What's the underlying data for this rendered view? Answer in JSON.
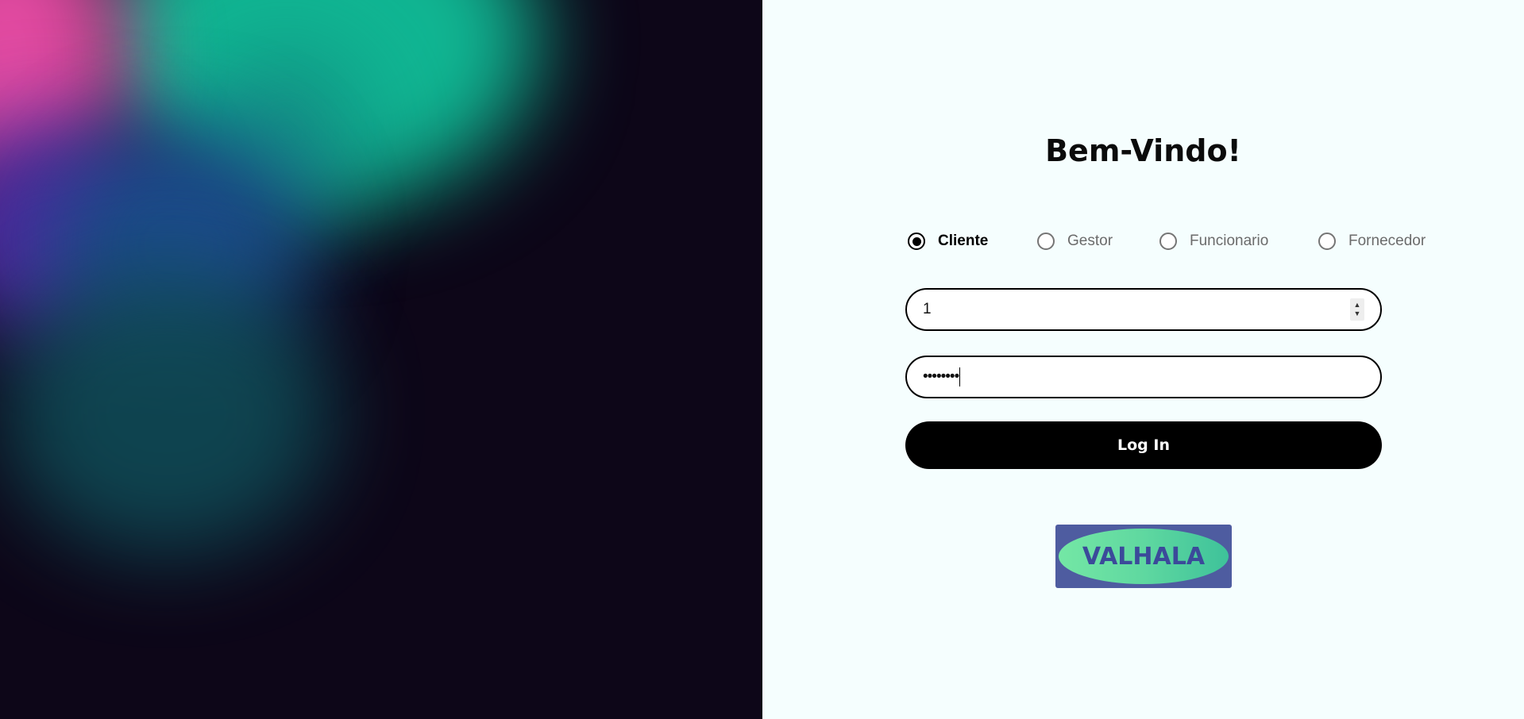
{
  "colors": {
    "left_background": "#0d0618",
    "right_background": "#f5fefe",
    "button_background": "#000000",
    "button_text": "#ffffff",
    "logo_background": "#4e5ca0",
    "logo_text": "#3b4a9a"
  },
  "login": {
    "title": "Bem-Vindo!",
    "roles": [
      {
        "label": "Cliente",
        "selected": true
      },
      {
        "label": "Gestor",
        "selected": false
      },
      {
        "label": "Funcionario",
        "selected": false
      },
      {
        "label": "Fornecedor",
        "selected": false
      }
    ],
    "id_field": {
      "value": "1"
    },
    "password_field": {
      "value": "••••••••"
    },
    "submit_label": "Log In",
    "logo_text": "VALHALA"
  }
}
